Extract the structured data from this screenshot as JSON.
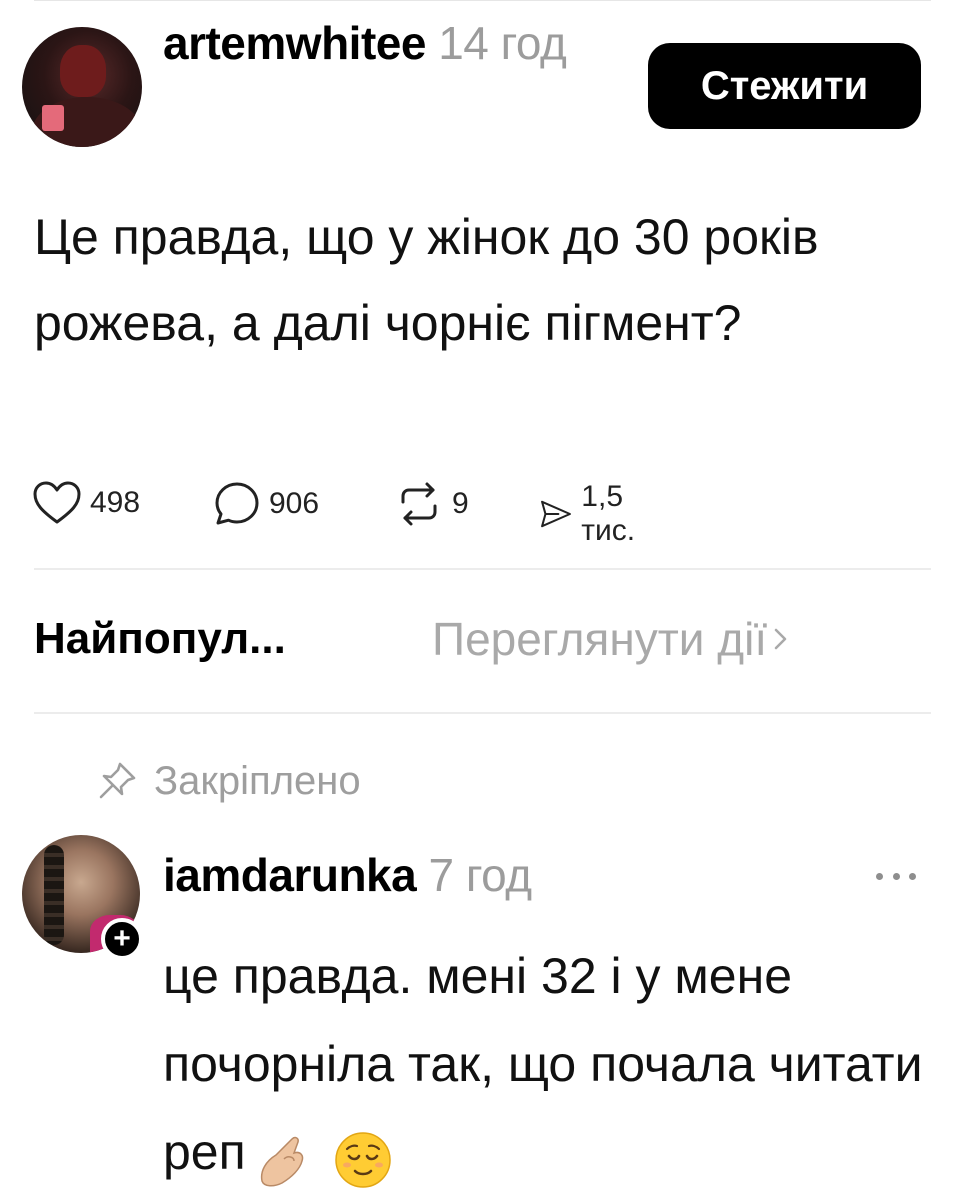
{
  "post": {
    "username": "artemwhitee",
    "time": "14 год",
    "follow_label": "Стежити",
    "text": "Це правда, що у жінок до 30 років рожева, а далі чорніє пігмент?",
    "stats": {
      "likes": "498",
      "replies": "906",
      "reposts": "9",
      "shares": "1,5 тис."
    },
    "icons": {
      "like": "heart-icon",
      "reply": "comment-icon",
      "repost": "repost-icon",
      "share": "send-icon"
    }
  },
  "sort": {
    "label": "Найпопул...",
    "activity_link": "Переглянути дії"
  },
  "pinned_reply": {
    "pinned_label": "Закріплено",
    "username": "iamdarunka",
    "time": "7 год",
    "plus_badge": "+",
    "text": "це правда. мені 32 і у мене почорніла так, що почала читати реп",
    "emojis": [
      "pinched-fingers-emoji",
      "relieved-face-emoji"
    ]
  },
  "colors": {
    "text": "#000000",
    "muted": "#9c9c9c",
    "button_bg": "#000000",
    "button_text": "#ffffff",
    "divider": "#ececec"
  }
}
